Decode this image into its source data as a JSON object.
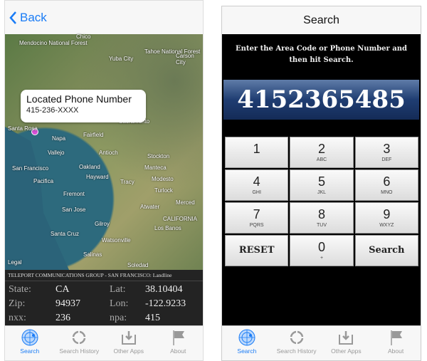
{
  "left": {
    "nav": {
      "back_label": "Back"
    },
    "map": {
      "places": [
        {
          "name": "Chico",
          "pos": "p0"
        },
        {
          "name": "Mendocino National Forest",
          "pos": "p1"
        },
        {
          "name": "Tahoe National Forest",
          "pos": "p2"
        },
        {
          "name": "Yuba City",
          "pos": "p3"
        },
        {
          "name": "Carson City",
          "pos": "p4"
        },
        {
          "name": "Santa Rosa",
          "pos": "p5"
        },
        {
          "name": "Napa",
          "pos": "p6"
        },
        {
          "name": "Fairfield",
          "pos": "p7"
        },
        {
          "name": "Sacramento",
          "pos": "p8"
        },
        {
          "name": "Vallejo",
          "pos": "p9"
        },
        {
          "name": "Antioch",
          "pos": "p10"
        },
        {
          "name": "Stockton",
          "pos": "p11"
        },
        {
          "name": "San Francisco",
          "pos": "p12"
        },
        {
          "name": "Oakland",
          "pos": "p13"
        },
        {
          "name": "Hayward",
          "pos": "p14"
        },
        {
          "name": "Manteca",
          "pos": "p15"
        },
        {
          "name": "Pacifica",
          "pos": "p16"
        },
        {
          "name": "Tracy",
          "pos": "p17"
        },
        {
          "name": "Modesto",
          "pos": "p18"
        },
        {
          "name": "Fremont",
          "pos": "p19"
        },
        {
          "name": "Turlock",
          "pos": "p20"
        },
        {
          "name": "San Jose",
          "pos": "p21"
        },
        {
          "name": "Atwater",
          "pos": "p22"
        },
        {
          "name": "Merced",
          "pos": "p23"
        },
        {
          "name": "CALIFORNIA",
          "pos": "p24"
        },
        {
          "name": "Gilroy",
          "pos": "p25"
        },
        {
          "name": "Los Banos",
          "pos": "p26"
        },
        {
          "name": "Santa Cruz",
          "pos": "p27"
        },
        {
          "name": "Watsonville",
          "pos": "p28"
        },
        {
          "name": "Salinas",
          "pos": "p29"
        },
        {
          "name": "Soledad",
          "pos": "p30"
        }
      ],
      "legal": "Legal",
      "callout": {
        "title": "Located Phone Number",
        "subtitle": "415-236-XXXX"
      }
    },
    "info": {
      "carrier": "TELEPORT COMMUNICATIONS GROUP - SAN FRANCISCO: Landline",
      "rows": [
        [
          "State:",
          "CA",
          "Lat:",
          "38.10404"
        ],
        [
          "Zip:",
          "94937",
          "Lon:",
          "-122.9233"
        ],
        [
          "nxx:",
          "236",
          "npa:",
          "415"
        ]
      ]
    }
  },
  "right": {
    "nav": {
      "title": "Search"
    },
    "instructions": "Enter the Area Code or Phone Number and then hit Search.",
    "display_value": "4152365485",
    "keys": [
      {
        "n": "1",
        "l": ""
      },
      {
        "n": "2",
        "l": "ABC"
      },
      {
        "n": "3",
        "l": "DEF"
      },
      {
        "n": "4",
        "l": "GHI"
      },
      {
        "n": "5",
        "l": "JKL"
      },
      {
        "n": "6",
        "l": "MNO"
      },
      {
        "n": "7",
        "l": "PQRS"
      },
      {
        "n": "8",
        "l": "TUV"
      },
      {
        "n": "9",
        "l": "WXYZ"
      },
      {
        "n": "RESET",
        "l": ""
      },
      {
        "n": "0",
        "l": "+"
      },
      {
        "n": "Search",
        "l": ""
      }
    ]
  },
  "tabs": [
    {
      "label": "Search",
      "icon": "radar-icon",
      "active": true
    },
    {
      "label": "Search History",
      "icon": "crosshair-icon"
    },
    {
      "label": "Other Apps",
      "icon": "download-tray-icon"
    },
    {
      "label": "About",
      "icon": "flag-icon"
    }
  ],
  "colors": {
    "accent": "#1a7cf6",
    "pin": "#d64fd6",
    "display": "#1f3d72"
  }
}
